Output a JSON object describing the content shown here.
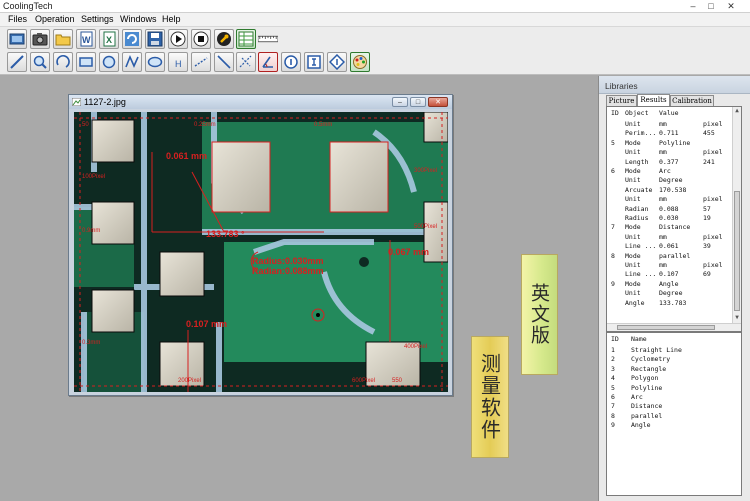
{
  "app": {
    "title": "CoolingTech"
  },
  "window_controls": {
    "minimize": "–",
    "maximize": "□",
    "close": "✕"
  },
  "menu": [
    "Files",
    "Operation",
    "Settings",
    "Windows",
    "Help"
  ],
  "toolbar": {
    "row1": [
      "open-icon",
      "camera-icon",
      "folder-icon",
      "word-export-icon",
      "excel-export-icon",
      "refresh-icon",
      "save-icon",
      "play-icon",
      "stop-icon",
      "wrench-icon",
      "grid-table-icon",
      "ruler-icon"
    ],
    "row2": [
      "line-icon",
      "zoom-icon",
      "circle-arc-icon",
      "rectangle-icon",
      "circle-icon",
      "polyline-icon",
      "ellipse-icon",
      "h-text-icon",
      "distance-icon",
      "diagonal-icon",
      "crosshair-icon",
      "angle-tool-icon",
      "info-circle-icon",
      "info-box-icon",
      "diamond-icon",
      "palette-icon"
    ],
    "ruler_label": "cm"
  },
  "image_window": {
    "title": "1127-2.jpg",
    "annotations": {
      "top_measure": "0.061 mm",
      "angle": "133.783 °",
      "radius": "Radius:0.030mm",
      "radian": "Radian:0.088mm",
      "right_measure": "0.067 mm",
      "bottom_measure": "0.107 mm"
    },
    "ruler_labels": [
      "50",
      "0.25mm",
      "0.5mm",
      "400Pixel",
      "300Pixel",
      "500Pixel",
      "200Pixel",
      "600Pixel",
      "550",
      "100Pixel",
      "0.9mm",
      "0.3mm"
    ]
  },
  "banners": {
    "english": "英文版",
    "chinese": "测量软件"
  },
  "libraries": {
    "title": "Libraries",
    "tabs": [
      "Picture",
      "Results",
      "Calibration"
    ],
    "selected_tab": "Results",
    "results_header": [
      "ID",
      "Object",
      "Value"
    ],
    "results_rows": [
      [
        "",
        "Unit",
        "mm",
        "pixel"
      ],
      [
        "",
        "Perim...",
        "0.711",
        "455"
      ],
      [
        "5",
        "Mode",
        "Polyline",
        ""
      ],
      [
        "",
        "Unit",
        "mm",
        "pixel"
      ],
      [
        "",
        "Length",
        "0.377",
        "241"
      ],
      [
        "6",
        "Mode",
        "Arc",
        ""
      ],
      [
        "",
        "Unit",
        "Degree",
        ""
      ],
      [
        "",
        "Arcuate",
        "170.538",
        ""
      ],
      [
        "",
        "Unit",
        "mm",
        "pixel"
      ],
      [
        "",
        "Radian",
        "0.088",
        "57"
      ],
      [
        "",
        "Radius",
        "0.030",
        "19"
      ],
      [
        "7",
        "Mode",
        "Distance",
        ""
      ],
      [
        "",
        "Unit",
        "mm",
        "pixel"
      ],
      [
        "",
        "Line ...",
        "0.061",
        "39"
      ],
      [
        "8",
        "Mode",
        "parallel",
        ""
      ],
      [
        "",
        "Unit",
        "mm",
        "pixel"
      ],
      [
        "",
        "Line ...",
        "0.107",
        "69"
      ],
      [
        "9",
        "Mode",
        "Angle",
        ""
      ],
      [
        "",
        "Unit",
        "Degree",
        ""
      ],
      [
        "",
        "Angle",
        "133.783",
        ""
      ]
    ],
    "library_header": [
      "ID",
      "Name"
    ],
    "library_rows": [
      [
        "1",
        "Straight Line"
      ],
      [
        "2",
        "Cyclometry"
      ],
      [
        "3",
        "Rectangle"
      ],
      [
        "4",
        "Polygon"
      ],
      [
        "5",
        "Polyline"
      ],
      [
        "6",
        "Arc"
      ],
      [
        "7",
        "Distance"
      ],
      [
        "8",
        "parallel"
      ],
      [
        "9",
        "Angle"
      ]
    ]
  }
}
